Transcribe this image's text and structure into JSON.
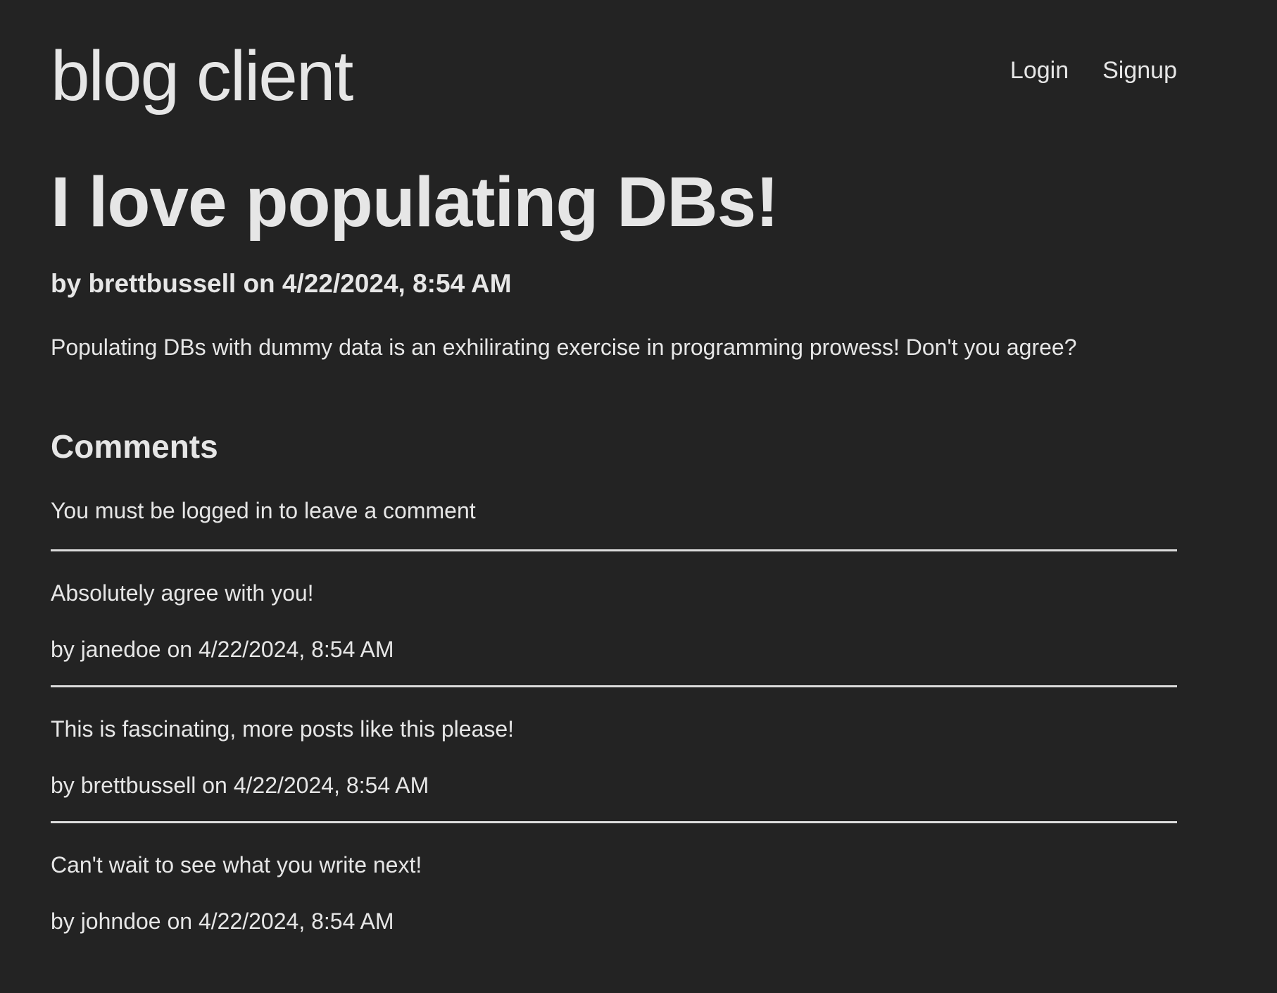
{
  "header": {
    "site_title": "blog client",
    "nav": {
      "login_label": "Login",
      "signup_label": "Signup"
    }
  },
  "post": {
    "title": "I love populating DBs!",
    "meta": "by brettbussell on 4/22/2024, 8:54 AM",
    "body": "Populating DBs with dummy data is an exhilirating exercise in programming prowess! Don't you agree?"
  },
  "comments_section": {
    "heading": "Comments",
    "login_notice": "You must be logged in to leave a comment",
    "items": [
      {
        "text": "Absolutely agree with you!",
        "meta": "by janedoe on 4/22/2024, 8:54 AM"
      },
      {
        "text": "This is fascinating, more posts like this please!",
        "meta": "by brettbussell on 4/22/2024, 8:54 AM"
      },
      {
        "text": "Can't wait to see what you write next!",
        "meta": "by johndoe on 4/22/2024, 8:54 AM"
      }
    ]
  },
  "colors": {
    "background": "#232323",
    "text": "#e6e6e6",
    "divider": "#dcdcdc"
  }
}
